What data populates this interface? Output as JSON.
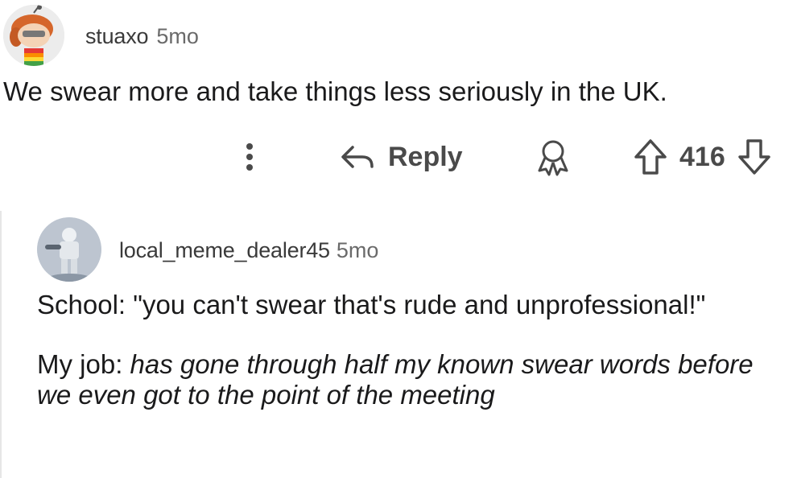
{
  "comment": {
    "author": "stuaxo",
    "age": "5mo",
    "body": "We swear more and take things less seriously in the UK.",
    "actions": {
      "reply_label": "Reply",
      "score": "416",
      "more_icon": "more-vertical-icon",
      "reply_icon": "reply-arrow-icon",
      "award_icon": "award-icon",
      "upvote_icon": "upvote-arrow-icon",
      "downvote_icon": "downvote-arrow-icon"
    }
  },
  "reply": {
    "author": "local_meme_dealer45",
    "age": "5mo",
    "paragraph1": "School: \"you can't swear that's rude and unprofessional!\"",
    "paragraph2_prefix": "My job: ",
    "paragraph2_italic": "has gone through half my known swear words before we even got to the point of the meeting"
  },
  "colors": {
    "text": "#1a1a1b",
    "meta": "#6a6a6a",
    "action": "#4a4a4a",
    "thread_line": "#e6e6e6"
  }
}
